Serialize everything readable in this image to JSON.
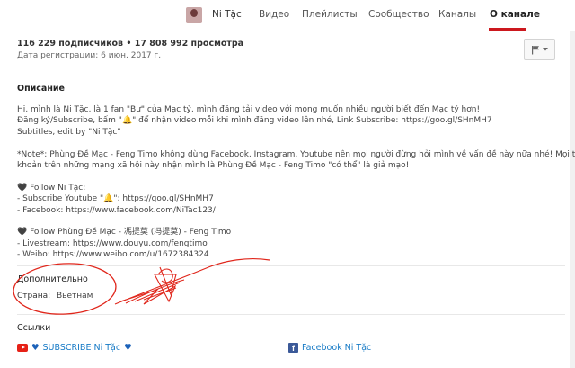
{
  "nav": {
    "channel_name": "Ni Tặc",
    "tabs": [
      "Видео",
      "Плейлисты",
      "Сообщество",
      "Каналы",
      "О канале"
    ],
    "active_tab": "О канале"
  },
  "stats": {
    "subscribers": "116 229 подписчиков",
    "separator": " • ",
    "views": "17 808 992 просмотра",
    "registration": "Дата регистрации: 6 июн. 2017 г."
  },
  "description": {
    "title": "Описание",
    "lines": [
      "Hi, mình là Ni Tặc, là 1 fan \"Bư\" của Mạc tỷ, mình đăng tải video với mong muốn nhiều người biết đến Mạc tỷ hơn!",
      "Đăng ký/Subscribe, bấm \"🔔\" để nhận video mỗi khi mình đăng video lên nhé, Link Subscribe: https://goo.gl/SHnMH7",
      "Subtitles, edit by \"Ni Tặc\"",
      "",
      "*Note*: Phùng Đề Mạc - Feng Timo không dùng Facebook, Instagram, Youtube nên mọi người đừng hỏi mình về vấn đề này nữa nhé! Mọi tài",
      "khoản trên những mạng xã hội này nhận mình là Phùng Đề Mạc - Feng Timo \"có thể\" là giả mạo!",
      "",
      "🖤 Follow Ni Tặc:",
      "- Subscribe Youtube \"🔔\": https://goo.gl/SHnMH7",
      "- Facebook: https://www.facebook.com/NiTac123/",
      "",
      "🖤 Follow Phùng Đề Mạc - 馮提莫 (冯提莫) - Feng Timo",
      "- Livestream: https://www.douyu.com/fengtimo",
      "- Weibo: https://www.weibo.com/u/1672384324"
    ]
  },
  "additional": {
    "title": "Дополнительно",
    "country_label": "Страна:",
    "country_value": "Вьетнам"
  },
  "links": {
    "title": "Ссылки",
    "subscribe": "SUBSCRIBE Ni Tặc",
    "facebook": "Facebook Ni Tặc"
  },
  "colors": {
    "accent": "#cc181e",
    "link": "#167ac6",
    "annotation": "#e0261b"
  },
  "icons": [
    "flag-icon",
    "chevron-down-icon",
    "youtube-icon",
    "heart-icon",
    "facebook-icon"
  ]
}
